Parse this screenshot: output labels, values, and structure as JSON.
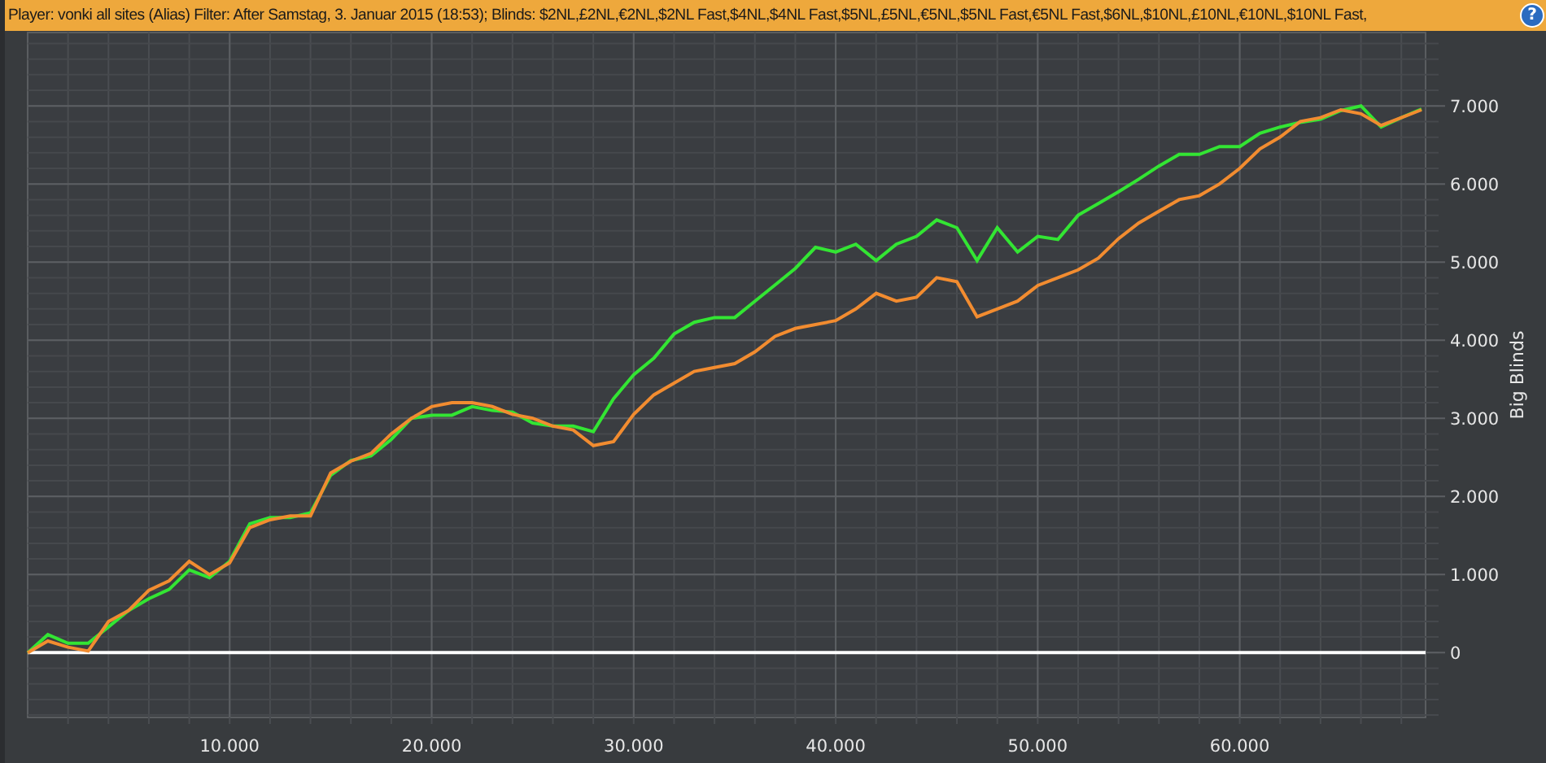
{
  "header": {
    "text": "Player:  vonki all sites (Alias)  Filter:  After Samstag, 3. Januar 2015 (18:53); Blinds: $2NL,£2NL,€2NL,$2NL Fast,$4NL,$4NL Fast,$5NL,£5NL,€5NL,$5NL Fast,€5NL Fast,$6NL,$10NL,£10NL,€10NL,$10NL Fast,",
    "help": "?"
  },
  "chart_data": {
    "type": "line",
    "grid": true,
    "ylabel": "Big Blinds",
    "x": [
      0,
      1000,
      2000,
      3000,
      4000,
      5000,
      6000,
      7000,
      8000,
      9000,
      10000,
      11000,
      12000,
      13000,
      14000,
      15000,
      16000,
      17000,
      18000,
      19000,
      20000,
      21000,
      22000,
      23000,
      24000,
      25000,
      26000,
      27000,
      28000,
      29000,
      30000,
      31000,
      32000,
      33000,
      34000,
      35000,
      36000,
      37000,
      38000,
      39000,
      40000,
      41000,
      42000,
      43000,
      44000,
      45000,
      46000,
      47000,
      48000,
      49000,
      50000,
      51000,
      52000,
      53000,
      54000,
      55000,
      56000,
      57000,
      58000,
      59000,
      60000,
      61000,
      62000,
      63000,
      64000,
      65000,
      66000,
      67000,
      68000,
      69000
    ],
    "series": [
      {
        "color": "#33e533",
        "values": [
          0,
          230,
          120,
          120,
          330,
          540,
          690,
          810,
          1060,
          960,
          1170,
          1650,
          1730,
          1730,
          1790,
          2270,
          2460,
          2520,
          2730,
          3000,
          3040,
          3040,
          3150,
          3100,
          3080,
          2940,
          2900,
          2900,
          2830,
          3250,
          3560,
          3770,
          4080,
          4230,
          4290,
          4290,
          4500,
          4710,
          4920,
          5190,
          5130,
          5230,
          5020,
          5230,
          5330,
          5540,
          5440,
          5020,
          5440,
          5130,
          5330,
          5290,
          5600,
          5750,
          5900,
          6060,
          6230,
          6380,
          6380,
          6480,
          6480,
          6650,
          6730,
          6790,
          6830,
          6940,
          7000,
          6730,
          6850,
          6960
        ]
      },
      {
        "color": "#f28c30",
        "values": [
          0,
          150,
          70,
          20,
          400,
          540,
          800,
          920,
          1170,
          1000,
          1150,
          1600,
          1700,
          1750,
          1750,
          2300,
          2450,
          2550,
          2800,
          3000,
          3150,
          3200,
          3200,
          3150,
          3050,
          3000,
          2900,
          2850,
          2650,
          2700,
          3050,
          3300,
          3450,
          3600,
          3650,
          3700,
          3850,
          4050,
          4150,
          4200,
          4250,
          4400,
          4600,
          4500,
          4550,
          4800,
          4750,
          4300,
          4400,
          4500,
          4700,
          4800,
          4900,
          5050,
          5300,
          5500,
          5650,
          5800,
          5850,
          6000,
          6200,
          6450,
          6600,
          6800,
          6850,
          6950,
          6900,
          6750,
          6850,
          6950
        ]
      }
    ],
    "xlim": [
      0,
      69200
    ],
    "ylim": [
      -830,
      7940
    ],
    "xticks": [
      {
        "value": 10000,
        "label": "10.000"
      },
      {
        "value": 20000,
        "label": "20.000"
      },
      {
        "value": 30000,
        "label": "30.000"
      },
      {
        "value": 40000,
        "label": "40.000"
      },
      {
        "value": 50000,
        "label": "50.000"
      },
      {
        "value": 60000,
        "label": "60.000"
      }
    ],
    "yticks": [
      {
        "value": 0,
        "label": "0"
      },
      {
        "value": 1000,
        "label": "1.000"
      },
      {
        "value": 2000,
        "label": "2.000"
      },
      {
        "value": 3000,
        "label": "3.000"
      },
      {
        "value": 4000,
        "label": "4.000"
      },
      {
        "value": 5000,
        "label": "5.000"
      },
      {
        "value": 6000,
        "label": "6.000"
      },
      {
        "value": 7000,
        "label": "7.000"
      }
    ]
  }
}
